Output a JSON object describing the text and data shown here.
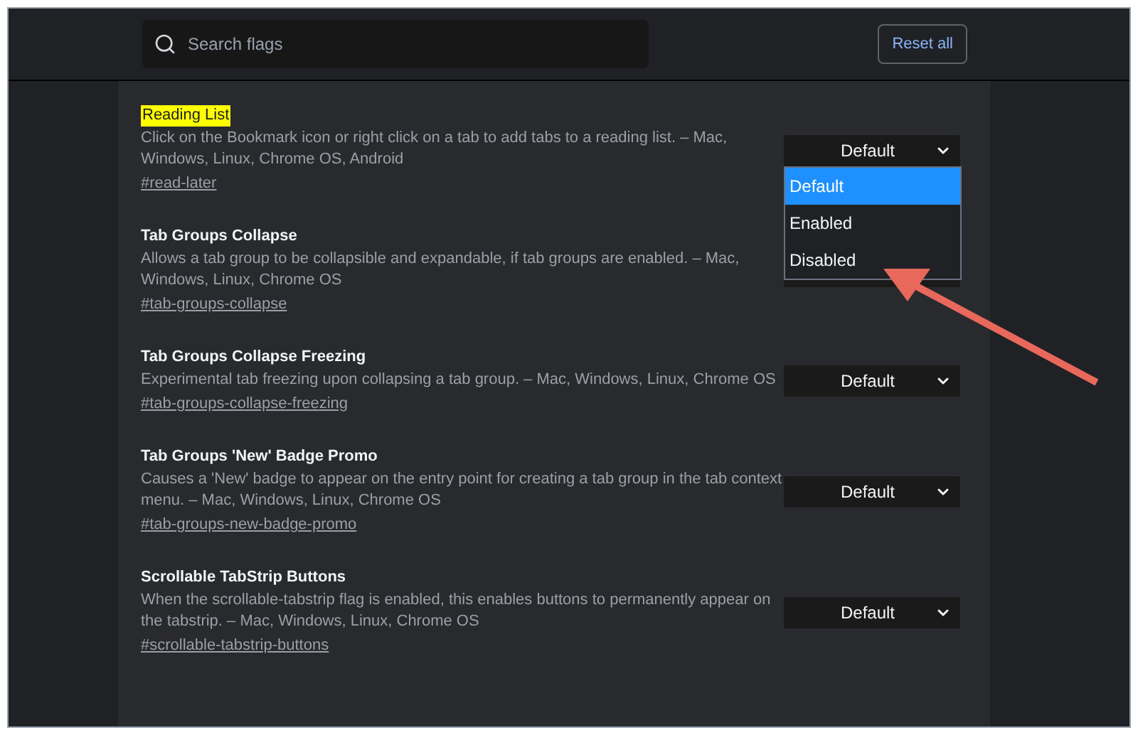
{
  "search": {
    "placeholder": "Search flags"
  },
  "reset_button": "Reset all",
  "flags": [
    {
      "title": "Reading List",
      "highlighted": true,
      "description": "Click on the Bookmark icon or right click on a tab to add tabs to a reading list. – Mac, Windows, Linux, Chrome OS, Android",
      "link": "#read-later",
      "select": "Default",
      "expanded": true
    },
    {
      "title": "Tab Groups Collapse",
      "highlighted": false,
      "description": "Allows a tab group to be collapsible and expandable, if tab groups are enabled. – Mac, Windows, Linux, Chrome OS",
      "link": "#tab-groups-collapse",
      "expanded": false
    },
    {
      "title": "Tab Groups Collapse Freezing",
      "highlighted": false,
      "description": "Experimental tab freezing upon collapsing a tab group. – Mac, Windows, Linux, Chrome OS",
      "link": "#tab-groups-collapse-freezing",
      "select": "Default",
      "expanded": false
    },
    {
      "title": "Tab Groups 'New' Badge Promo",
      "highlighted": false,
      "description": "Causes a 'New' badge to appear on the entry point for creating a tab group in the tab context menu. – Mac, Windows, Linux, Chrome OS",
      "link": "#tab-groups-new-badge-promo",
      "select": "Default",
      "expanded": false
    },
    {
      "title": "Scrollable TabStrip Buttons",
      "highlighted": false,
      "description": "When the scrollable-tabstrip flag is enabled, this enables buttons to permanently appear on the tabstrip. – Mac, Windows, Linux, Chrome OS",
      "link": "#scrollable-tabstrip-buttons",
      "select": "Default",
      "expanded": false
    }
  ],
  "dropdown_options": [
    {
      "label": "Default",
      "selected": true
    },
    {
      "label": "Enabled",
      "selected": false
    },
    {
      "label": "Disabled",
      "selected": false
    }
  ]
}
